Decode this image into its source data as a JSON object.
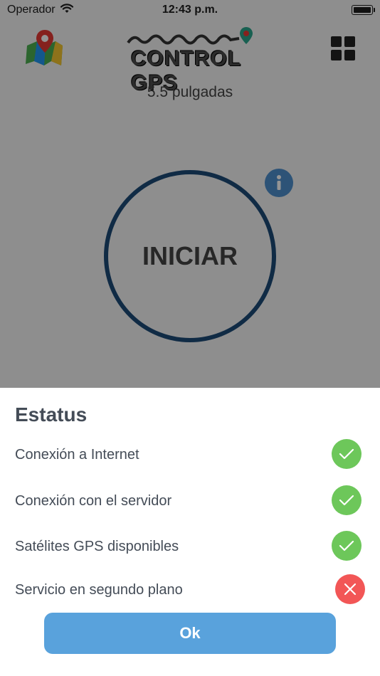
{
  "status_bar": {
    "carrier": "Operador",
    "time": "12:43 p.m."
  },
  "main": {
    "logo_text": "CONTROL GPS",
    "screen_size": "5.5 pulgadas",
    "start_label": "INICIAR",
    "info_icon": "info-icon",
    "menu_icon": "grid-menu-icon",
    "map_icon": "map-pin-icon"
  },
  "sheet": {
    "title": "Estatus",
    "items": [
      {
        "label": "Conexión a Internet",
        "state": "ok",
        "icon": "check-icon"
      },
      {
        "label": "Conexión con el servidor",
        "state": "ok",
        "icon": "check-icon"
      },
      {
        "label": "Satélites GPS disponibles",
        "state": "ok",
        "icon": "check-icon"
      },
      {
        "label": "Servicio en segundo plano",
        "state": "fail",
        "icon": "close-icon"
      }
    ],
    "ok_label": "Ok"
  },
  "colors": {
    "ok": "#6dc75a",
    "fail": "#f25656",
    "button": "#59a2dc",
    "ring": "#1d4a78"
  }
}
